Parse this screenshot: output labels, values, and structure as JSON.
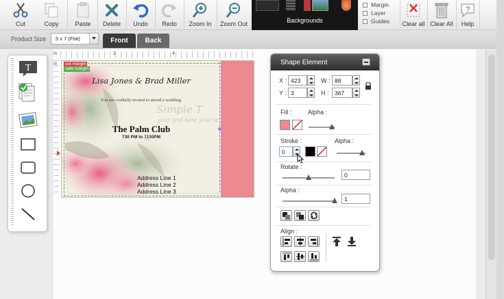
{
  "toolbar": {
    "cut": "Cut",
    "copy": "Copy",
    "paste": "Paste",
    "delete": "Delete",
    "undo": "Undo",
    "redo": "Redo",
    "zoom_in": "Zoom In",
    "zoom_out": "Zoom Out",
    "backgrounds": "Backgrounds",
    "margin": "Margin",
    "layer": "Layer",
    "guides": "Guides",
    "clear_all_1": "Clear all",
    "clear_all_2": "Clear All",
    "help": "Help"
  },
  "sizebar": {
    "product_size_label": "Product Size",
    "product_size_value": "5 x 7 (Flat)",
    "tab_front": "Front",
    "tab_back": "Back"
  },
  "rulers": {
    "top_0": "in",
    "top_2": "2",
    "top_4": "4",
    "left_0": "in"
  },
  "card": {
    "cut_margin": "cut margin",
    "safe_margin": "safe margin",
    "names": "Lisa Jones & Brad Miller",
    "invite": "You are cordially invited to attend a wedding.",
    "placeholder_1": "Simple T",
    "placeholder_2": "your text here your te",
    "placeholder_3": "ht",
    "club": "The Palm Club",
    "time": "730 PM to 1130PM",
    "address_1": "Address Line 1",
    "address_2": "Address Line 2",
    "address_3": "Address Line 3"
  },
  "shape_panel": {
    "title": "Shape Element",
    "x_label": "X :",
    "x_value": "423",
    "w_label": "W :",
    "w_value": "88",
    "y_label": "Y :",
    "y_value": "3",
    "h_label": "H :",
    "h_value": "367",
    "fill_label": "Fill :",
    "fill_alpha_label": "Alpha :",
    "stroke_label": "Stroke :",
    "stroke_value": "0",
    "stroke_alpha_label": "Alpha :",
    "rotate_label": "Rotate :",
    "rotate_value": "0",
    "alpha_label": "Alpha :",
    "alpha_value": "1",
    "align_label": "Align :",
    "fill_color": "#ec8a8e",
    "stroke_color": "#000000"
  },
  "colors": {
    "accent_pink": "#ec7e85",
    "tab_active": "#3a3a3a",
    "tab_inactive": "#666666"
  }
}
